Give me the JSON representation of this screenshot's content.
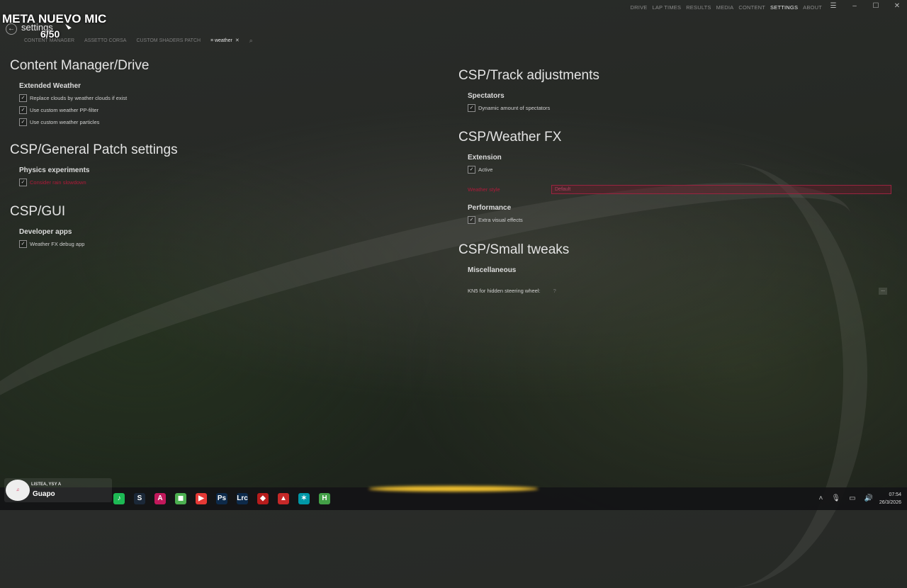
{
  "overlay": {
    "title": "META NUEVO MIC",
    "counter": "6/50"
  },
  "page": {
    "title": "settings"
  },
  "topnav": [
    "DRIVE",
    "LAP TIMES",
    "RESULTS",
    "MEDIA",
    "CONTENT",
    "SETTINGS",
    "ABOUT"
  ],
  "topnav_active": "SETTINGS",
  "subnav": {
    "items": [
      "CONTENT MANAGER",
      "ASSETTO CORSA",
      "CUSTOM SHADERS PATCH"
    ],
    "active_tab": "weather",
    "active_prefix": "⌗"
  },
  "left": {
    "sections": [
      {
        "title": "Content Manager/Drive",
        "group": "Extended Weather",
        "options": [
          "Replace clouds by weather clouds if exist",
          "Use custom weather PP-filter",
          "Use custom weather particles"
        ]
      },
      {
        "title": "CSP/General Patch settings",
        "group": "Physics experiments",
        "options": [
          "Consider rain slowdown"
        ]
      },
      {
        "title": "CSP/GUI",
        "group": "Developer apps",
        "options": [
          "Weather FX debug app"
        ]
      }
    ]
  },
  "right": {
    "track": {
      "title": "CSP/Track adjustments",
      "group": "Spectators",
      "option": "Dynamic amount of spectators"
    },
    "weatherfx": {
      "title": "CSP/Weather FX",
      "group": "Extension",
      "option": "Active",
      "preset_label": "Weather style",
      "preset_value": "Default"
    },
    "performance": {
      "group": "Performance",
      "option": "Extra visual effects"
    },
    "tweaks": {
      "title": "CSP/Small tweaks",
      "group": "Miscellaneous",
      "kn5_label": "KN5 for hidden steering wheel:",
      "kn5_value": "?",
      "more": "..."
    }
  },
  "taskbar": {
    "now_playing": {
      "artist": "LISTEA, YSY A",
      "title": "Guapo"
    },
    "apps": [
      {
        "icon": "spotify-icon",
        "glyph": "♪",
        "color": "#1db954"
      },
      {
        "icon": "steam-icon",
        "glyph": "S",
        "color": "#1b2838"
      },
      {
        "icon": "app-a-icon",
        "glyph": "A",
        "color": "#c2185b"
      },
      {
        "icon": "minecraft-icon",
        "glyph": "◼",
        "color": "#4caf50"
      },
      {
        "icon": "youtube-icon",
        "glyph": "▶",
        "color": "#e53935"
      },
      {
        "icon": "photoshop-icon",
        "glyph": "Ps",
        "color": "#0d2a4a"
      },
      {
        "icon": "lrc-icon",
        "glyph": "Lrc",
        "color": "#0d2a4a"
      },
      {
        "icon": "app-red-icon",
        "glyph": "◆",
        "color": "#b71c1c"
      },
      {
        "icon": "assetto-icon",
        "glyph": "▲",
        "color": "#c62828"
      },
      {
        "icon": "app-cyan-icon",
        "glyph": "✶",
        "color": "#0097a7"
      },
      {
        "icon": "app-h-icon",
        "glyph": "H",
        "color": "#43a047"
      }
    ],
    "time": "07:54",
    "date": "26/3/2026"
  }
}
